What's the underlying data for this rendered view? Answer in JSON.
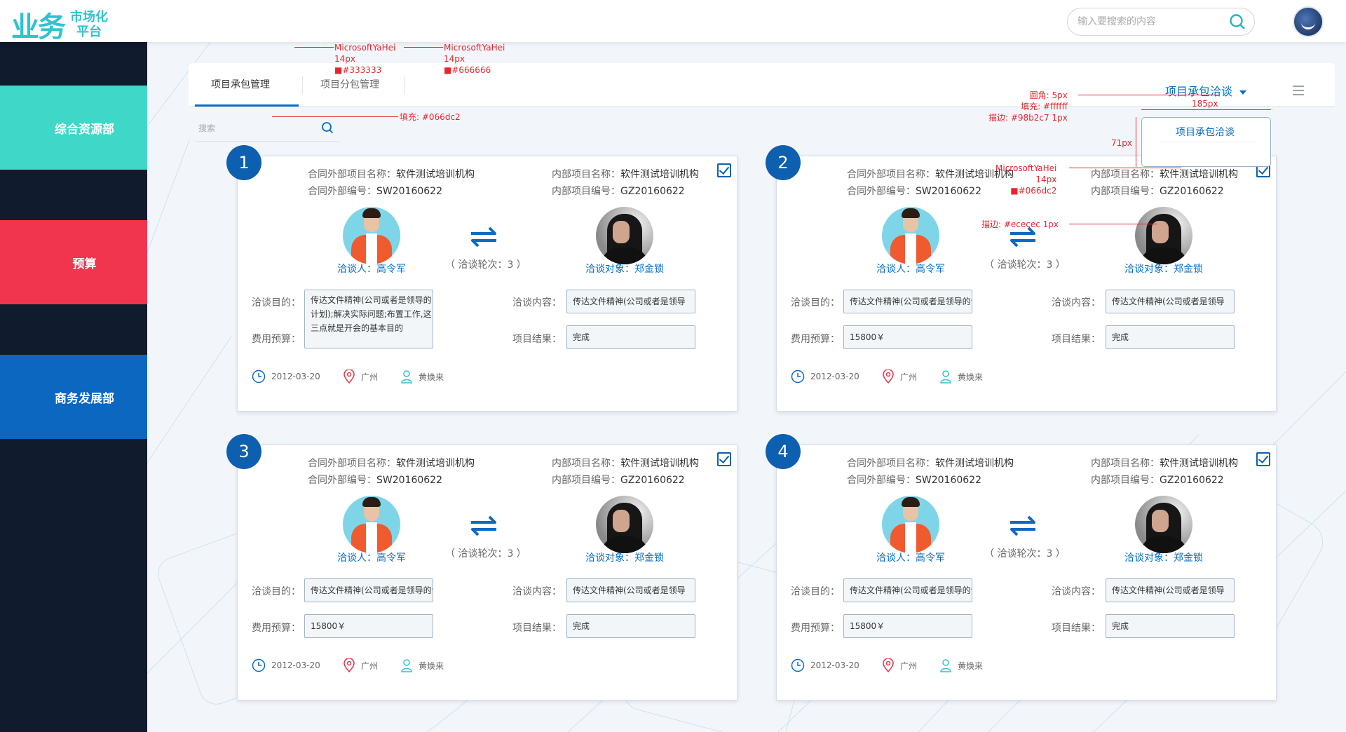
{
  "header": {
    "logo_mark": "业务",
    "logo_line1": "市场化",
    "logo_line2": "平台",
    "search_placeholder": "输入要搜索的内容"
  },
  "sidebar": {
    "items": [
      {
        "label": "综合资源部",
        "color": "#3fd8c8"
      },
      {
        "label": "预算",
        "color": "#f2354f"
      },
      {
        "label": "商务发展部",
        "color": "#0c67c1"
      }
    ]
  },
  "tabs": [
    {
      "label": "项目承包管理"
    },
    {
      "label": "项目分包管理"
    }
  ],
  "dropdown": {
    "label": "项目承包洽谈",
    "option": "项目承包洽谈"
  },
  "filter": {
    "placeholder": "搜索"
  },
  "annotations": {
    "a1": [
      "MicrosoftYaHei",
      "14px",
      "#333333"
    ],
    "a2": [
      "MicrosoftYaHei",
      "14px",
      "#666666"
    ],
    "a3": "填充: #066dc2",
    "a4": [
      "圆角: 5px",
      "填充: #ffffff",
      "描边: #98b2c7 1px"
    ],
    "a5": "185px",
    "a6": "71px",
    "a7": [
      "MicrosoftYaHei",
      "14px",
      "#066dc2"
    ],
    "a8": "描边: #ececec 1px"
  },
  "colors": {
    "accent": "#066dc2",
    "border": "#98b2c7"
  },
  "cards": [
    {
      "num": "1",
      "ext_name_label": "合同外部项目名称：",
      "ext_name": "软件测试培训机构",
      "ext_no_label": "合同外部编号：",
      "ext_no": "SW20160622",
      "int_name_label": "内部项目名称：",
      "int_name": "软件测试培训机构",
      "int_no_label": "内部项目编号：",
      "int_no": "GZ20160622",
      "negotiator": "洽谈人：高令军",
      "rounds": "（ 洽谈轮次：3 ）",
      "target": "洽谈对象：郑金锁",
      "purpose_label": "洽谈目的：",
      "purpose": "传达文件精神(公司或者是领导的计划);解决实际问题;布置工作,这三点就是开会的基本目的",
      "content_label": "洽谈内容：",
      "content": "传达文件精神(公司或者是领导",
      "budget_label": "费用预算：",
      "budget": "",
      "result_label": "项目结果：",
      "result": "完成",
      "date": "2012-03-20",
      "city": "广州",
      "owner": "黄焕来"
    },
    {
      "num": "2",
      "ext_name_label": "合同外部项目名称：",
      "ext_name": "软件测试培训机构",
      "ext_no_label": "合同外部编号：",
      "ext_no": "SW20160622",
      "int_name_label": "内部项目名称：",
      "int_name": "软件测试培训机构",
      "int_no_label": "内部项目编号：",
      "int_no": "GZ20160622",
      "negotiator": "洽谈人：高令军",
      "rounds": "（ 洽谈轮次：3 ）",
      "target": "洽谈对象：郑金锁",
      "purpose_label": "洽谈目的：",
      "purpose": "传达文件精神(公司或者是领导的计",
      "content_label": "洽谈内容：",
      "content": "传达文件精神(公司或者是领导",
      "budget_label": "费用预算：",
      "budget": "15800￥",
      "result_label": "项目结果：",
      "result": "完成",
      "date": "2012-03-20",
      "city": "广州",
      "owner": "黄焕来"
    },
    {
      "num": "3",
      "ext_name_label": "合同外部项目名称：",
      "ext_name": "软件测试培训机构",
      "ext_no_label": "合同外部编号：",
      "ext_no": "SW20160622",
      "int_name_label": "内部项目名称：",
      "int_name": "软件测试培训机构",
      "int_no_label": "内部项目编号：",
      "int_no": "GZ20160622",
      "negotiator": "洽谈人：高令军",
      "rounds": "（ 洽谈轮次：3 ）",
      "target": "洽谈对象：郑金锁",
      "purpose_label": "洽谈目的：",
      "purpose": "传达文件精神(公司或者是领导的计",
      "content_label": "洽谈内容：",
      "content": "传达文件精神(公司或者是领导",
      "budget_label": "费用预算：",
      "budget": "15800￥",
      "result_label": "项目结果：",
      "result": "完成",
      "date": "2012-03-20",
      "city": "广州",
      "owner": "黄焕来"
    },
    {
      "num": "4",
      "ext_name_label": "合同外部项目名称：",
      "ext_name": "软件测试培训机构",
      "ext_no_label": "合同外部编号：",
      "ext_no": "SW20160622",
      "int_name_label": "内部项目名称：",
      "int_name": "软件测试培训机构",
      "int_no_label": "内部项目编号：",
      "int_no": "GZ20160622",
      "negotiator": "洽谈人：高令军",
      "rounds": "（ 洽谈轮次：3 ）",
      "target": "洽谈对象：郑金锁",
      "purpose_label": "洽谈目的：",
      "purpose": "传达文件精神(公司或者是领导的计",
      "content_label": "洽谈内容：",
      "content": "传达文件精神(公司或者是领导",
      "budget_label": "费用预算：",
      "budget": "15800￥",
      "result_label": "项目结果：",
      "result": "完成",
      "date": "2012-03-20",
      "city": "广州",
      "owner": "黄焕来"
    }
  ]
}
